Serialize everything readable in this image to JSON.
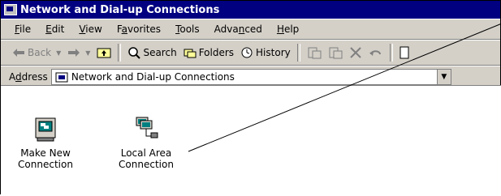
{
  "window": {
    "title": "Network and Dial-up Connections"
  },
  "menu": {
    "items": [
      {
        "label": "File",
        "underline": "F",
        "rest": "ile"
      },
      {
        "label": "Edit",
        "underline": "E",
        "rest": "dit"
      },
      {
        "label": "View",
        "underline": "V",
        "rest": "iew"
      },
      {
        "label": "Favorites",
        "underline": "a",
        "pre": "F",
        "rest": "vorites"
      },
      {
        "label": "Tools",
        "underline": "T",
        "rest": "ools"
      },
      {
        "label": "Advanced",
        "underline": "n",
        "pre": "Adva",
        "rest": "ced"
      },
      {
        "label": "Help",
        "underline": "H",
        "rest": "elp"
      }
    ]
  },
  "toolbar": {
    "back_label": "Back",
    "search_label": "Search",
    "folders_label": "Folders",
    "history_label": "History"
  },
  "address": {
    "label": "Address",
    "value": "Network and Dial-up Connections"
  },
  "icons": [
    {
      "line1": "Make New",
      "line2": "Connection"
    },
    {
      "line1": "Local Area",
      "line2": "Connection"
    }
  ]
}
